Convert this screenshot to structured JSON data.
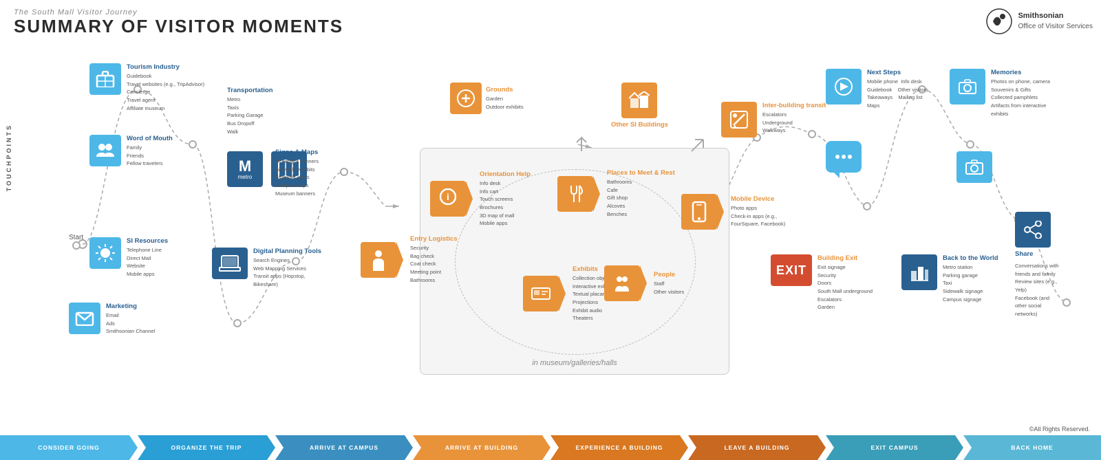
{
  "header": {
    "subtitle": "The South Mall Visitor Journey",
    "title": "SUMMARY OF VISITOR MOMENTS"
  },
  "logo": {
    "name": "Smithsonian",
    "dept": "Office of Visitor Services"
  },
  "copyright": "©All Rights Reserved.",
  "touchpoints_label": "TOUCHPOINTS",
  "nodes": {
    "tourism": {
      "title": "Tourism Industry",
      "items": [
        "Guidebook",
        "Travel websites (e.g., TripAdvisor)",
        "Concierge",
        "Travel agent",
        "Affiliate museum"
      ]
    },
    "word_of_mouth": {
      "title": "Word of Mouth",
      "items": [
        "Family",
        "Friends",
        "Fellow travelers"
      ]
    },
    "marketing": {
      "title": "Marketing",
      "items": [
        "Email",
        "Ads",
        "Smithsonian Channel"
      ]
    },
    "si_resources": {
      "title": "SI Resources",
      "items": [
        "Telephone Line",
        "Direct Mail",
        "Website",
        "Mobile apps"
      ]
    },
    "transportation": {
      "title": "Transportation",
      "items": [
        "Metro",
        "Taxis",
        "Parking Garage",
        "Bus Dropoff",
        "Walk"
      ]
    },
    "signs_maps": {
      "title": "Signs & Maps",
      "items": [
        "Streetlight banners",
        "Sidewalk exhibits",
        "Sidewalk signs",
        "Campus maps",
        "Museum banners"
      ]
    },
    "digital_planning": {
      "title": "Digital Planning Tools",
      "items": [
        "Search Engines",
        "Web Mapping Services",
        "Transit apps (Hopstop, Bikeshare)"
      ]
    },
    "grounds": {
      "title": "Grounds",
      "items": [
        "Garden",
        "Outdoor exhibits"
      ]
    },
    "entry_logistics": {
      "title": "Entry Logistics",
      "items": [
        "Security",
        "Bag check",
        "Coat check",
        "Meeting point",
        "Bathrooms"
      ]
    },
    "orientation_help": {
      "title": "Orientation Help",
      "items": [
        "Info desk",
        "Info cart",
        "Touch screens",
        "Brochures",
        "3D map of mall",
        "Mobile apps"
      ]
    },
    "places_to_meet": {
      "title": "Places to Meet & Rest",
      "items": [
        "Bathrooms",
        "Cafe",
        "Gift shop",
        "Alcoves",
        "Benches"
      ]
    },
    "exhibits": {
      "title": "Exhibits",
      "items": [
        "Collection objects",
        "Interactive exhibits",
        "Textual placards",
        "Projections",
        "Exhibit audio",
        "Theaters"
      ]
    },
    "people": {
      "title": "People",
      "items": [
        "Staff",
        "Other visitors"
      ]
    },
    "mobile_device": {
      "title": "Mobile Device",
      "items": [
        "Photo apps",
        "Check-in apps (e.g., FourSquare, Facebook)"
      ]
    },
    "other_si_buildings": {
      "title": "Other SI Buildings",
      "items": []
    },
    "inter_building_transit": {
      "title": "Inter-building transit",
      "items": [
        "Escalators",
        "Underground",
        "Walkways"
      ]
    },
    "building_exit": {
      "title": "Building Exit",
      "items": [
        "Exit signage",
        "Security",
        "Doors",
        "South Mall underground",
        "Escalators",
        "Garden"
      ]
    },
    "next_steps": {
      "title": "Next Steps",
      "items": [
        "Mobile phone",
        "Info desk",
        "Guidebook",
        "Other visitors",
        "Takeaways",
        "Mailing list",
        "Maps"
      ]
    },
    "memories": {
      "title": "Memories",
      "items": [
        "Photos on phone, camera",
        "Souvenirs & Gifts",
        "Collected pamphlets",
        "Artifacts from interactive exhibits"
      ]
    },
    "back_to_world": {
      "title": "Back to the World",
      "items": [
        "Metro station",
        "Parking garage",
        "Taxi",
        "Sidewalk signage",
        "Campus signage"
      ]
    },
    "share": {
      "title": "Share",
      "items": [
        "Conversations with friends and family",
        "Review sites (e.g., Yelp)",
        "Facebook (and other social networks)"
      ]
    }
  },
  "bottom_bar": {
    "segments": [
      {
        "label": "CONSIDER GOING",
        "color": "#4db8e8"
      },
      {
        "label": "ORGANIZE THE TRIP",
        "color": "#2a9fd6"
      },
      {
        "label": "ARRIVE AT CAMPUS",
        "color": "#3a8fc0"
      },
      {
        "label": "ARRIVE AT BUILDING",
        "color": "#e8933a"
      },
      {
        "label": "EXPERIENCE A BUILDING",
        "color": "#d97820"
      },
      {
        "label": "LEAVE A BUILDING",
        "color": "#c96820"
      },
      {
        "label": "EXIT CAMPUS",
        "color": "#3a9eb8"
      },
      {
        "label": "BACK HOME",
        "color": "#5ab8d6"
      }
    ]
  },
  "museum_label": "in museum/galleries/halls",
  "start_label": "Start"
}
